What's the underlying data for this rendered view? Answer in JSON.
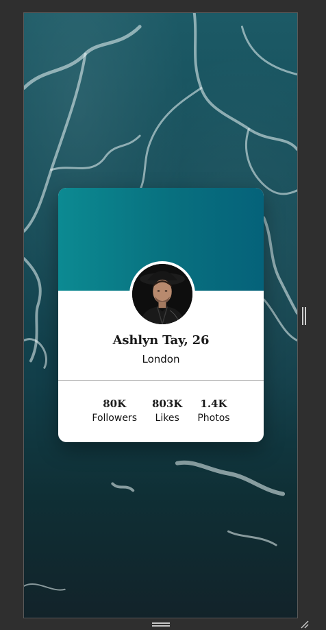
{
  "profile": {
    "name": "Ashlyn Tay, 26",
    "location": "London"
  },
  "stats": [
    {
      "value": "80K",
      "label": "Followers"
    },
    {
      "value": "803K",
      "label": "Likes"
    },
    {
      "value": "1.4K",
      "label": "Photos"
    }
  ],
  "colors": {
    "header_gradient_start": "#0c8a92",
    "header_gradient_end": "#05627a",
    "card_background": "#ffffff",
    "page_background": "#2f2f2f"
  },
  "icons": {
    "avatar": "profile-photo",
    "background": "ocean-water-texture"
  }
}
